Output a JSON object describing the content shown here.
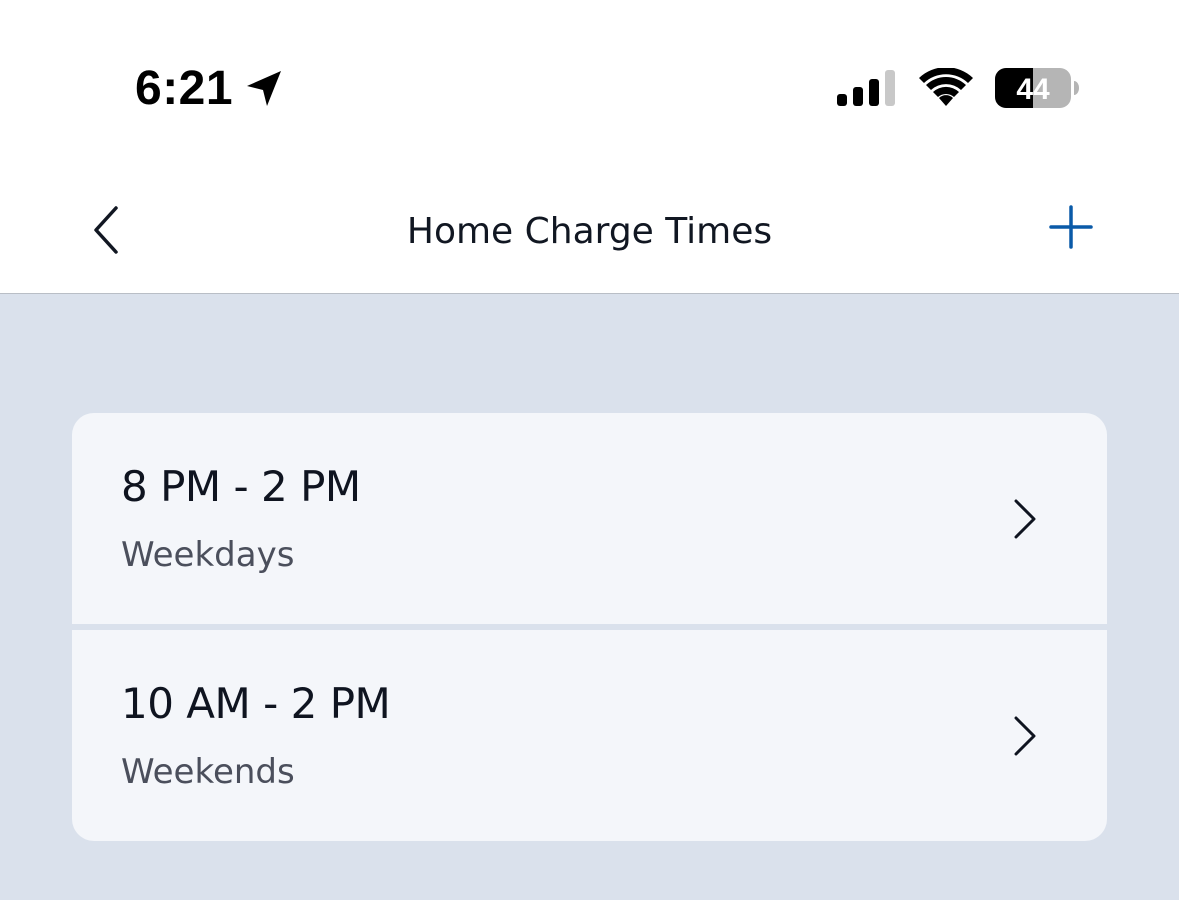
{
  "status_bar": {
    "time": "6:21",
    "battery_level": "44",
    "icons": [
      "location-arrow-icon",
      "cellular-signal-icon",
      "wifi-icon",
      "battery-icon"
    ]
  },
  "nav": {
    "title": "Home Charge Times",
    "back_icon": "chevron-left-icon",
    "add_icon": "plus-icon",
    "accent_color": "#0a5aa8"
  },
  "schedules": [
    {
      "time_range": "8 PM - 2 PM",
      "days": "Weekdays"
    },
    {
      "time_range": "10 AM - 2 PM",
      "days": "Weekends"
    }
  ],
  "colors": {
    "background": "#dae1ec",
    "card": "#f4f6fa",
    "primary_text": "#0f1420",
    "secondary_text": "#4b4f5c"
  }
}
